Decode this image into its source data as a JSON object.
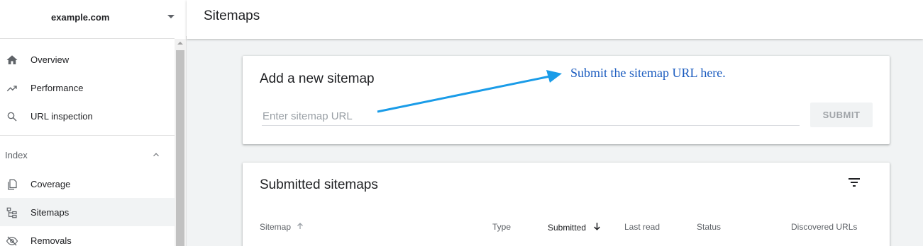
{
  "property": {
    "name": "example.com",
    "dropdown_icon": "caret-down-icon"
  },
  "nav": {
    "items": [
      {
        "label": "Overview",
        "icon": "home-icon"
      },
      {
        "label": "Performance",
        "icon": "trending-up-icon"
      },
      {
        "label": "URL inspection",
        "icon": "search-icon"
      }
    ],
    "index_section": {
      "label": "Index",
      "items": [
        {
          "label": "Coverage",
          "icon": "copy-pages-icon"
        },
        {
          "label": "Sitemaps",
          "icon": "sitemap-icon",
          "active": true
        },
        {
          "label": "Removals",
          "icon": "eye-off-icon"
        }
      ]
    }
  },
  "header": {
    "title": "Sitemaps"
  },
  "add_sitemap": {
    "title": "Add a new sitemap",
    "input_placeholder": "Enter sitemap URL",
    "input_value": "",
    "submit_label": "SUBMIT"
  },
  "annotation": {
    "text": "Submit the sitemap URL here.",
    "color": "#1a5bbf",
    "arrow_color": "#1a9ce8"
  },
  "submitted_sitemaps": {
    "title": "Submitted sitemaps",
    "columns": [
      "Sitemap",
      "Type",
      "Submitted",
      "Last read",
      "Status",
      "Discovered URLs"
    ],
    "sorted_column": "Submitted",
    "sort_direction": "descending"
  }
}
